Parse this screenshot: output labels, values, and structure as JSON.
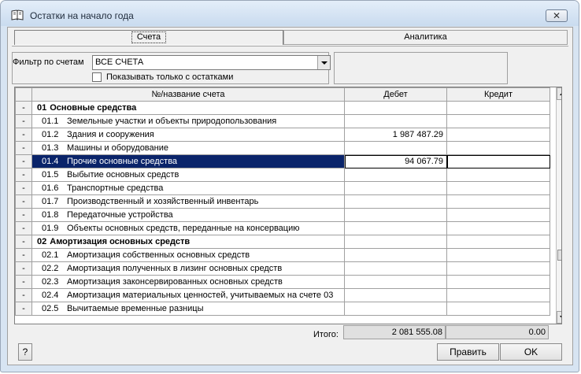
{
  "window": {
    "title": "Остатки на начало года",
    "close_label": "✕"
  },
  "tabs": [
    {
      "label": "Счета"
    },
    {
      "label": "Аналитика"
    }
  ],
  "filter": {
    "label": "Фильтр по счетам",
    "selected": "ВСЕ СЧЕТА",
    "checkbox_label": "Показывать только с остатками",
    "checkbox_checked": false
  },
  "columns": {
    "name": "№/название счета",
    "debit": "Дебет",
    "credit": "Кредит"
  },
  "rows": [
    {
      "mark": "-",
      "code": "01",
      "name": "Основные средства",
      "debit": "",
      "credit": "",
      "group": true
    },
    {
      "mark": "-",
      "code": "01.1",
      "name": "Земельные участки  и объекты природопользования",
      "debit": "",
      "credit": ""
    },
    {
      "mark": "-",
      "code": "01.2",
      "name": "Здания и сооружения",
      "debit": "1 987 487.29",
      "credit": ""
    },
    {
      "mark": "-",
      "code": "01.3",
      "name": "Машины и оборудование",
      "debit": "",
      "credit": ""
    },
    {
      "mark": "-",
      "code": "01.4",
      "name": "Прочие основные средства",
      "debit": "94 067.79",
      "credit": "",
      "selected": true
    },
    {
      "mark": "-",
      "code": "01.5",
      "name": "Выбытие основных средств",
      "debit": "",
      "credit": ""
    },
    {
      "mark": "-",
      "code": "01.6",
      "name": "Транспортные средства",
      "debit": "",
      "credit": ""
    },
    {
      "mark": "-",
      "code": "01.7",
      "name": "Производственный и хозяйственный инвентарь",
      "debit": "",
      "credit": ""
    },
    {
      "mark": "-",
      "code": "01.8",
      "name": "Передаточные устройства",
      "debit": "",
      "credit": ""
    },
    {
      "mark": "-",
      "code": "01.9",
      "name": "Объекты основных средств, переданные на консервацию",
      "debit": "",
      "credit": ""
    },
    {
      "mark": "-",
      "code": "02",
      "name": "Амортизация основных средств",
      "debit": "",
      "credit": "",
      "group": true
    },
    {
      "mark": "-",
      "code": "02.1",
      "name": "Амортизация собственных основных средств",
      "debit": "",
      "credit": ""
    },
    {
      "mark": "-",
      "code": "02.2",
      "name": "Амортизация полученных в лизинг основных средств",
      "debit": "",
      "credit": ""
    },
    {
      "mark": "-",
      "code": "02.3",
      "name": "Амортизация законсервированных основных средств",
      "debit": "",
      "credit": ""
    },
    {
      "mark": "-",
      "code": "02.4",
      "name": "Амортизация материальных ценностей, учитываемых на счете 03",
      "debit": "",
      "credit": ""
    },
    {
      "mark": "-",
      "code": "02.5",
      "name": "Вычитаемые временные разницы",
      "debit": "",
      "credit": ""
    }
  ],
  "totals": {
    "label": "Итого:",
    "debit": "2 081 555.08",
    "credit": "0.00"
  },
  "buttons": {
    "help": "?",
    "edit": "Править",
    "ok": "OK"
  }
}
